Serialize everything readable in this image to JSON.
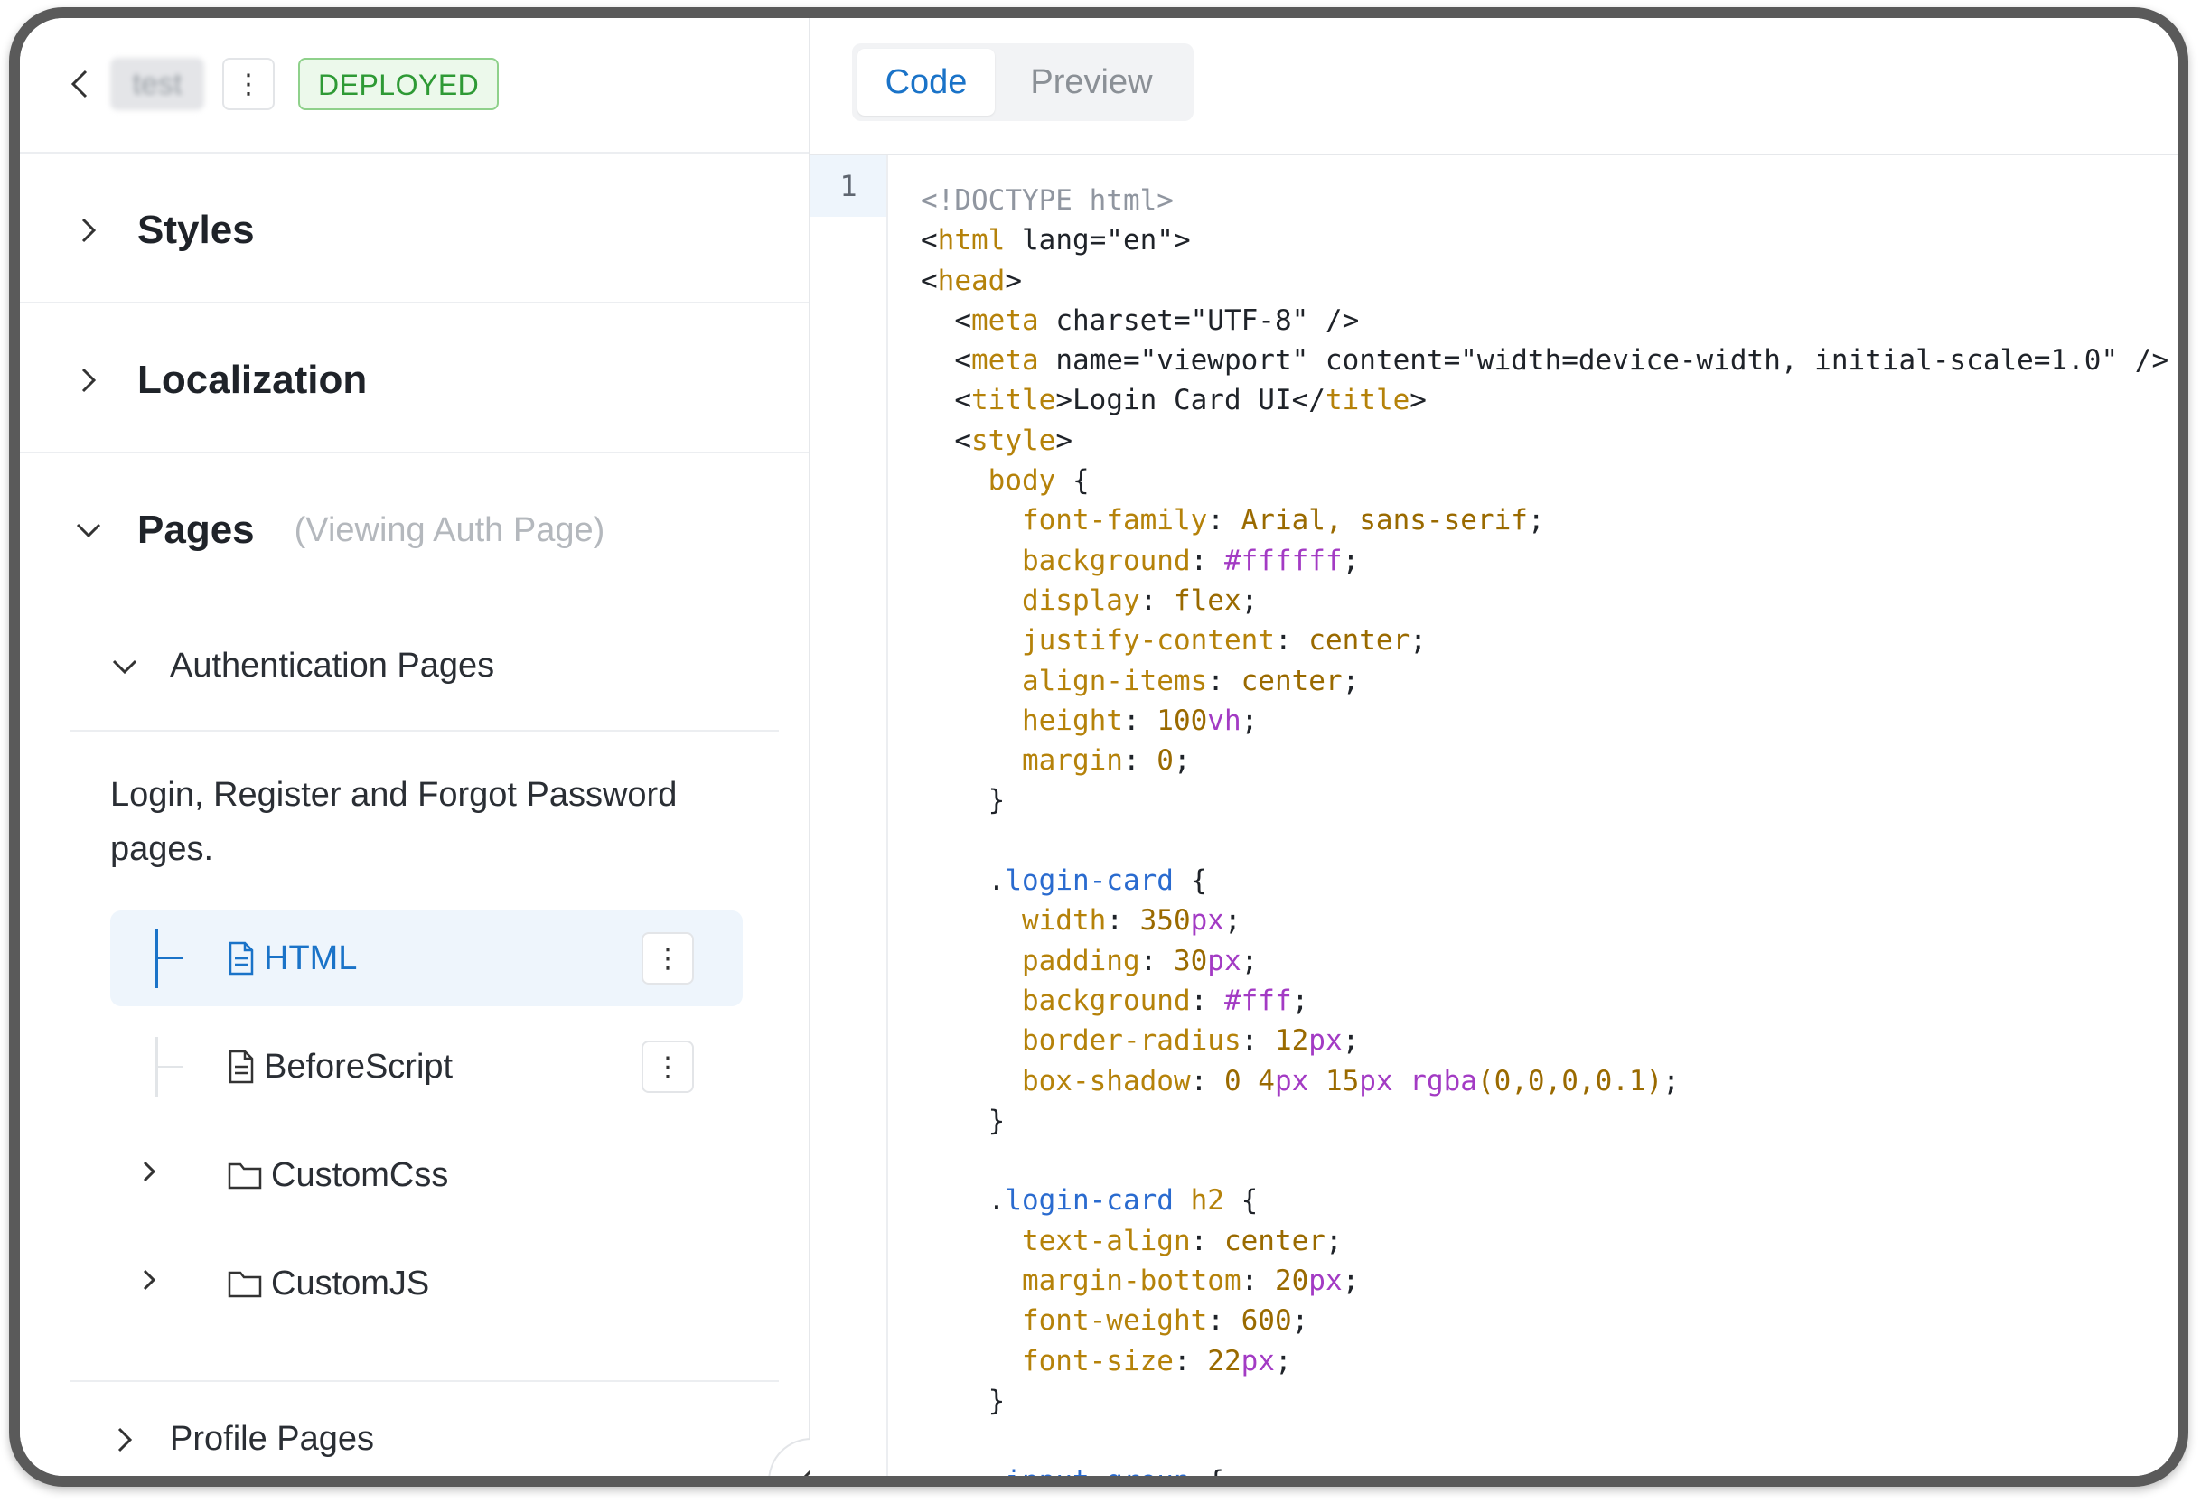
{
  "project": {
    "name": "test",
    "status_badge": "DEPLOYED"
  },
  "sidebar": {
    "sections": [
      {
        "title": "Styles",
        "expanded": false
      },
      {
        "title": "Localization",
        "expanded": false
      },
      {
        "title": "Pages",
        "expanded": true,
        "note": "(Viewing Auth Page)"
      }
    ],
    "groups": [
      {
        "title": "Authentication Pages",
        "expanded": true,
        "description": "Login, Register and Forgot Password pages.",
        "items": [
          {
            "label": "HTML",
            "type": "file",
            "active": true
          },
          {
            "label": "BeforeScript",
            "type": "file",
            "active": false
          },
          {
            "label": "CustomCss",
            "type": "folder",
            "active": false
          },
          {
            "label": "CustomJS",
            "type": "folder",
            "active": false
          }
        ]
      },
      {
        "title": "Profile Pages",
        "expanded": false
      }
    ]
  },
  "editor": {
    "tabs": [
      {
        "label": "Code",
        "active": true
      },
      {
        "label": "Preview",
        "active": false
      }
    ],
    "line_number": "1",
    "code_lines": [
      "<!DOCTYPE html>",
      "<html lang=\"en\">",
      "<head>",
      "  <meta charset=\"UTF-8\" />",
      "  <meta name=\"viewport\" content=\"width=device-width, initial-scale=1.0\" />",
      "  <title>Login Card UI</title>",
      "  <style>",
      "    body {",
      "      font-family: Arial, sans-serif;",
      "      background: #ffffff;",
      "      display: flex;",
      "      justify-content: center;",
      "      align-items: center;",
      "      height: 100vh;",
      "      margin: 0;",
      "    }",
      "",
      "    .login-card {",
      "      width: 350px;",
      "      padding: 30px;",
      "      background: #fff;",
      "      border-radius: 12px;",
      "      box-shadow: 0 4px 15px rgba(0,0,0,0.1);",
      "    }",
      "",
      "    .login-card h2 {",
      "      text-align: center;",
      "      margin-bottom: 20px;",
      "      font-weight: 600;",
      "      font-size: 22px;",
      "    }",
      "",
      "    .input-group {"
    ]
  }
}
